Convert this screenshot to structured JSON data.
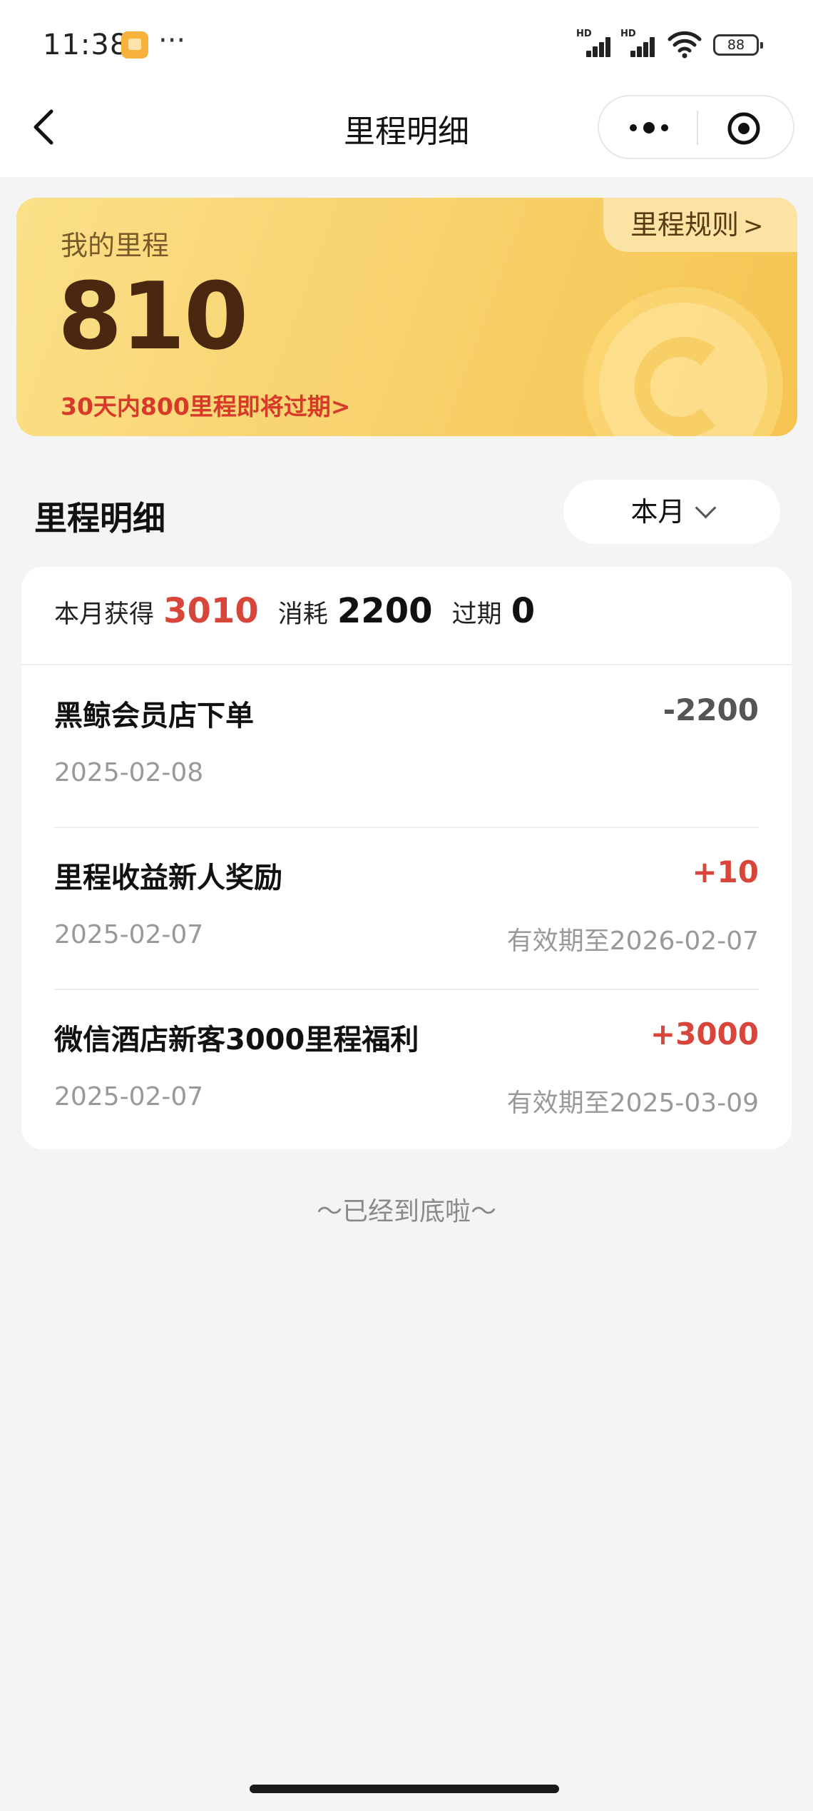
{
  "status_bar": {
    "time": "11:38",
    "more": "···",
    "hd1": "HD",
    "hd2": "HD",
    "battery": "88"
  },
  "nav": {
    "title": "里程明细"
  },
  "mileage_card": {
    "label": "我的里程",
    "value": "810",
    "expire_notice": "30天内800里程即将过期>",
    "rules_link": "里程规则"
  },
  "section": {
    "title": "里程明细",
    "filter": "本月"
  },
  "summary": {
    "earned_label": "本月获得",
    "earned_value": "3010",
    "consumed_label": "消耗",
    "consumed_value": "2200",
    "expired_label": "过期",
    "expired_value": "0"
  },
  "records": [
    {
      "title": "黑鲸会员店下单",
      "amount": "-2200",
      "date": "2025-02-08",
      "valid": ""
    },
    {
      "title": "里程收益新人奖励",
      "amount": "+10",
      "date": "2025-02-07",
      "valid": "有效期至2026-02-07"
    },
    {
      "title": "微信酒店新客3000里程福利",
      "amount": "+3000",
      "date": "2025-02-07",
      "valid": "有效期至2025-03-09"
    }
  ],
  "footer": {
    "end_text": "～已经到底啦～"
  },
  "colors": {
    "accent_red": "#d8453a",
    "card_gold": "#f8d36f",
    "value_brown": "#4a2810"
  }
}
